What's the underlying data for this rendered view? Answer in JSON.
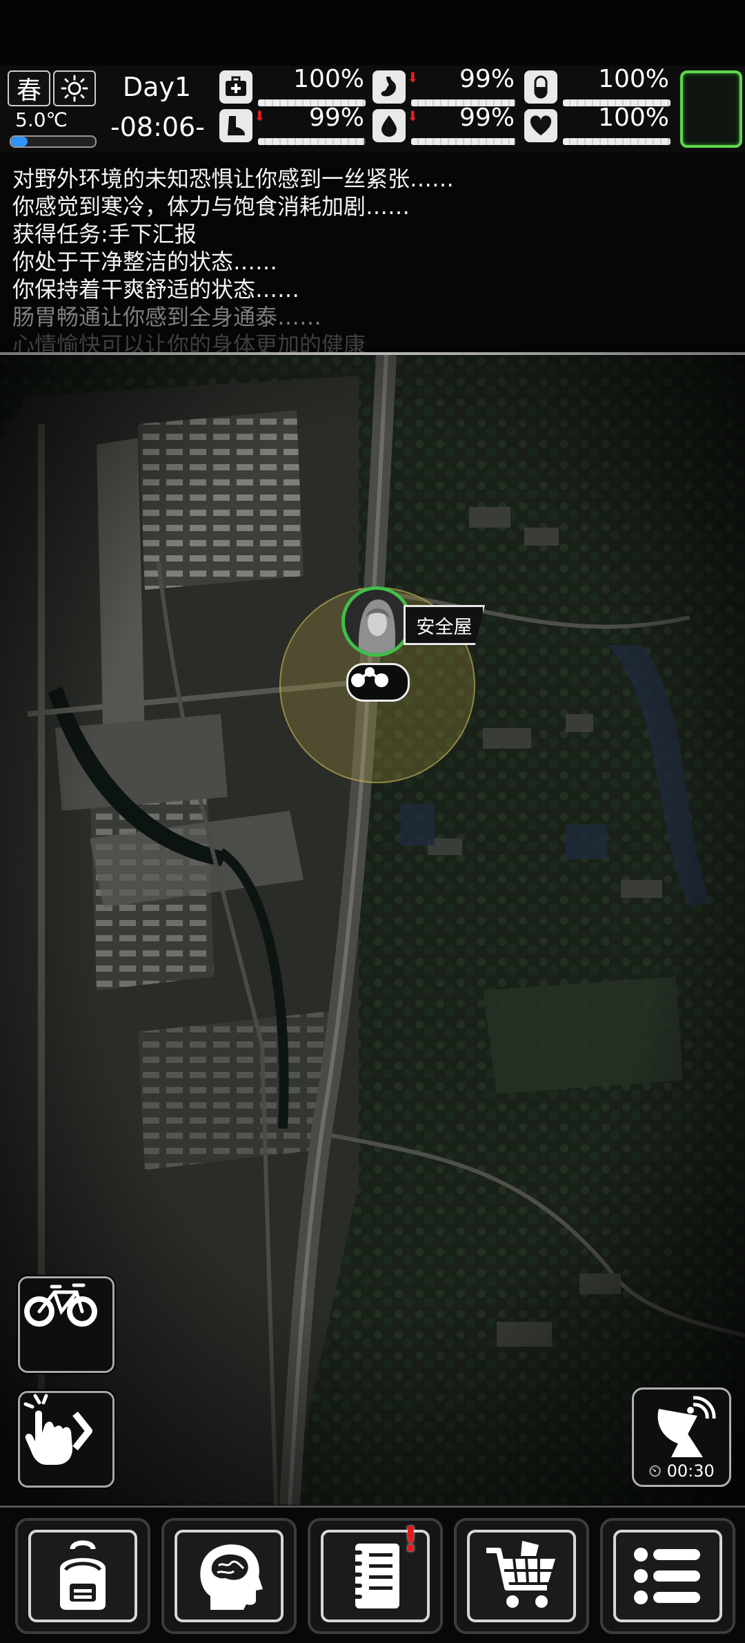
{
  "hud": {
    "season": "春",
    "weather_icon": "sun-icon",
    "temperature": "5.0℃",
    "temperature_level": 0.2,
    "day": "Day1",
    "time": "-08:06-",
    "stats": [
      {
        "name": "health",
        "icon": "medkit-icon",
        "value": "100%",
        "level": 1.0,
        "decreasing": false
      },
      {
        "name": "stomach",
        "icon": "stomach-icon",
        "value": "99%",
        "level": 0.99,
        "decreasing": true
      },
      {
        "name": "pills",
        "icon": "pill-icon",
        "value": "100%",
        "level": 1.0,
        "decreasing": false
      },
      {
        "name": "stamina",
        "icon": "boot-icon",
        "value": "99%",
        "level": 0.99,
        "decreasing": true
      },
      {
        "name": "water",
        "icon": "water-drop-icon",
        "value": "99%",
        "level": 0.99,
        "decreasing": true
      },
      {
        "name": "mood",
        "icon": "heart-icon",
        "value": "100%",
        "level": 1.0,
        "decreasing": false
      }
    ]
  },
  "log": [
    "对野外环境的未知恐惧让你感到一丝紧张……",
    "你感觉到寒冷，体力与饱食消耗加剧……",
    "获得任务:手下汇报",
    "你处于干净整洁的状态……",
    "你保持着干爽舒适的状态……",
    "肠胃畅通让你感到全身通泰……",
    "心情愉快可以让你的身体更加的健康"
  ],
  "map": {
    "location_label": "安全屋",
    "radar_timer": "00:30"
  },
  "bottom_nav": [
    "backpack",
    "skills",
    "quests",
    "shop",
    "menu"
  ],
  "colors": {
    "accent_green": "#5fd84c",
    "alert_red": "#e21b1b",
    "temp_blue": "#2f93ff"
  }
}
